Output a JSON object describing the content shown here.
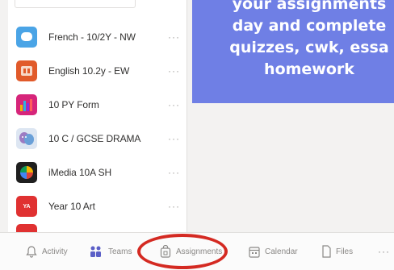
{
  "teams": [
    {
      "label": "French - 10/2Y - NW",
      "avatar_color": "#4aa4e6",
      "avatar_text": ""
    },
    {
      "label": "English 10.2y - EW",
      "avatar_color": "#e15a2a",
      "avatar_text": "✦"
    },
    {
      "label": "10 PY Form",
      "avatar_color": "#d6257a",
      "avatar_text": ""
    },
    {
      "label": "10 C / GCSE DRAMA",
      "avatar_color": "#8fb1d8",
      "avatar_text": ""
    },
    {
      "label": "iMedia 10A SH",
      "avatar_color": "#1f1f1f",
      "avatar_text": ""
    },
    {
      "label": "Year 10 Art",
      "avatar_color": "#e03131",
      "avatar_text": "YA"
    }
  ],
  "more_label": "···",
  "callout": {
    "line1": "your assignments",
    "line2": "day and complete",
    "line3": "quizzes, cwk, essa",
    "line4": "homework"
  },
  "nav": {
    "activity": "Activity",
    "teams": "Teams",
    "assignments": "Assignments",
    "calendar": "Calendar",
    "files": "Files",
    "more": "···"
  },
  "colors": {
    "callout_bg": "#6f7fe5",
    "ring": "#d42a22",
    "teams_icon": "#5b5fc7"
  }
}
